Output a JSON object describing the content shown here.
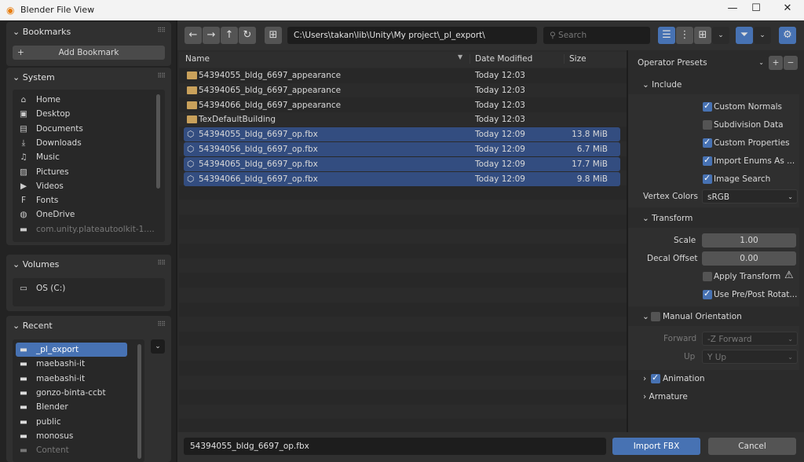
{
  "window": {
    "title": "Blender File View",
    "minimize": "—",
    "maximize": "☐",
    "close": "✕"
  },
  "sidebar": {
    "bookmarks": {
      "title": "Bookmarks",
      "add_label": "Add Bookmark"
    },
    "system": {
      "title": "System",
      "items": [
        {
          "label": "Home",
          "icon": "⌂"
        },
        {
          "label": "Desktop",
          "icon": "▣"
        },
        {
          "label": "Documents",
          "icon": "▤"
        },
        {
          "label": "Downloads",
          "icon": "⤓"
        },
        {
          "label": "Music",
          "icon": "♫"
        },
        {
          "label": "Pictures",
          "icon": "▨"
        },
        {
          "label": "Videos",
          "icon": "▶"
        },
        {
          "label": "Fonts",
          "icon": "F"
        },
        {
          "label": "OneDrive",
          "icon": "◍"
        },
        {
          "label": "com.unity.plateautoolkit-1....",
          "icon": "▬"
        }
      ]
    },
    "volumes": {
      "title": "Volumes",
      "items": [
        {
          "label": "OS (C:)"
        }
      ]
    },
    "recent": {
      "title": "Recent",
      "items": [
        {
          "label": "_pl_export",
          "selected": true
        },
        {
          "label": "maebashi-it"
        },
        {
          "label": "maebashi-it"
        },
        {
          "label": "gonzo-binta-ccbt"
        },
        {
          "label": "Blender"
        },
        {
          "label": "public"
        },
        {
          "label": "monosus"
        },
        {
          "label": "Content",
          "dim": true
        }
      ]
    }
  },
  "toolbar": {
    "path": "C:\\Users\\takan\\lib\\Unity\\My project\\_pl_export\\",
    "search_placeholder": "Search",
    "accent": "#4772b3"
  },
  "columns": {
    "name": "Name",
    "date": "Date Modified",
    "size": "Size"
  },
  "files": [
    {
      "name": "54394055_bldg_6697_appearance",
      "date": "Today 12:03",
      "size": "",
      "type": "folder",
      "selected": false
    },
    {
      "name": "54394065_bldg_6697_appearance",
      "date": "Today 12:03",
      "size": "",
      "type": "folder",
      "selected": false
    },
    {
      "name": "54394066_bldg_6697_appearance",
      "date": "Today 12:03",
      "size": "",
      "type": "folder",
      "selected": false
    },
    {
      "name": "TexDefaultBuilding",
      "date": "Today 12:03",
      "size": "",
      "type": "folder",
      "selected": false
    },
    {
      "name": "54394055_bldg_6697_op.fbx",
      "date": "Today 12:09",
      "size": "13.8 MiB",
      "type": "fbx",
      "selected": true
    },
    {
      "name": "54394056_bldg_6697_op.fbx",
      "date": "Today 12:09",
      "size": "6.7 MiB",
      "type": "fbx",
      "selected": true
    },
    {
      "name": "54394065_bldg_6697_op.fbx",
      "date": "Today 12:09",
      "size": "17.7 MiB",
      "type": "fbx",
      "selected": true
    },
    {
      "name": "54394066_bldg_6697_op.fbx",
      "date": "Today 12:09",
      "size": "9.8 MiB",
      "type": "fbx",
      "selected": true
    }
  ],
  "footer": {
    "filename": "54394055_bldg_6697_op.fbx",
    "import_label": "Import FBX",
    "cancel_label": "Cancel"
  },
  "options": {
    "presets": "Operator Presets",
    "include": {
      "title": "Include",
      "custom_normals": "Custom Normals",
      "subdivision": "Subdivision Data",
      "custom_props": "Custom Properties",
      "import_enums": "Import Enums As ...",
      "image_search": "Image Search",
      "vertex_colors_label": "Vertex Colors",
      "vertex_colors": "sRGB"
    },
    "transform": {
      "title": "Transform",
      "scale_label": "Scale",
      "scale": "1.00",
      "decal_label": "Decal Offset",
      "decal": "0.00",
      "apply_transform": "Apply Transform",
      "use_prepost": "Use Pre/Post Rotat..."
    },
    "manual": {
      "title": "Manual Orientation",
      "forward_label": "Forward",
      "forward": "-Z Forward",
      "up_label": "Up",
      "up": "Y Up"
    },
    "animation": "Animation",
    "armature": "Armature"
  }
}
